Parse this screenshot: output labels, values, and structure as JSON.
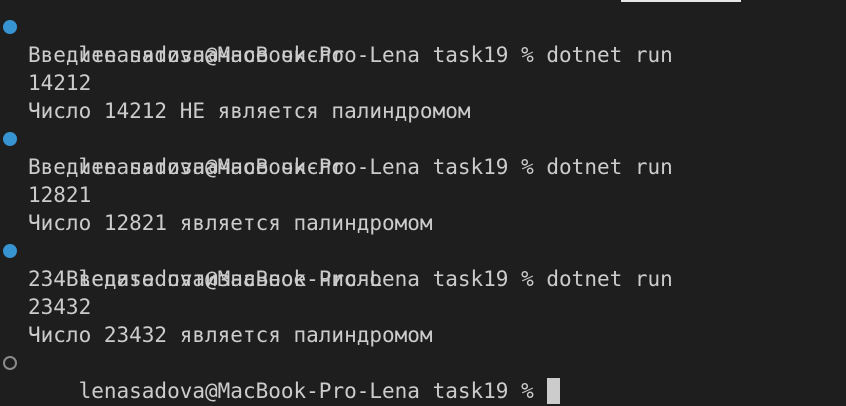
{
  "terminal": {
    "prompt": "lenasadova@MacBook-Pro-Lena task19 %",
    "blocks": [
      {
        "command": "dotnet run",
        "output": [
          "Введите пятизначное число",
          "14212",
          "Число 14212 НЕ является палиндромом"
        ]
      },
      {
        "command": "dotnet run",
        "output": [
          "Введите пятизначное число",
          "12821",
          "Число 12821 является палиндромом"
        ]
      },
      {
        "command": "dotnet run",
        "output": [
          "234Введите пятизначное число",
          "23432",
          "Число 23432 является палиндромом"
        ]
      }
    ],
    "current_input": ""
  },
  "colors": {
    "background": "#1e1e1e",
    "text": "#cccccc",
    "success_marker": "#3794d1",
    "idle_marker": "#8a8a8a"
  },
  "icons": {
    "success": "filled-circle-icon",
    "idle": "hollow-circle-icon"
  }
}
